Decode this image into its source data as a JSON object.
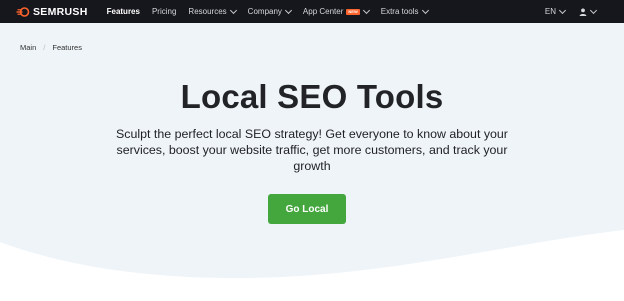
{
  "brand": {
    "name": "SEMRUSH",
    "accent": "#ff642d"
  },
  "nav": {
    "items": [
      {
        "label": "Features",
        "active": true,
        "dropdown": false
      },
      {
        "label": "Pricing",
        "active": false,
        "dropdown": false
      },
      {
        "label": "Resources",
        "active": false,
        "dropdown": true
      },
      {
        "label": "Company",
        "active": false,
        "dropdown": true
      },
      {
        "label": "App Center",
        "active": false,
        "dropdown": true,
        "badge": "new"
      },
      {
        "label": "Extra tools",
        "active": false,
        "dropdown": true
      }
    ],
    "language": "EN",
    "user_icon": "user-icon"
  },
  "breadcrumb": {
    "items": [
      "Main",
      "Features"
    ]
  },
  "hero": {
    "title": "Local SEO Tools",
    "subtitle": "Sculpt the perfect local SEO strategy! Get everyone to know about your services, boost your website traffic, get more customers, and track your growth",
    "cta_label": "Go Local",
    "cta_color": "#44a73e"
  },
  "colors": {
    "nav_bg": "#16171c",
    "hero_bg": "#eef4f8"
  }
}
